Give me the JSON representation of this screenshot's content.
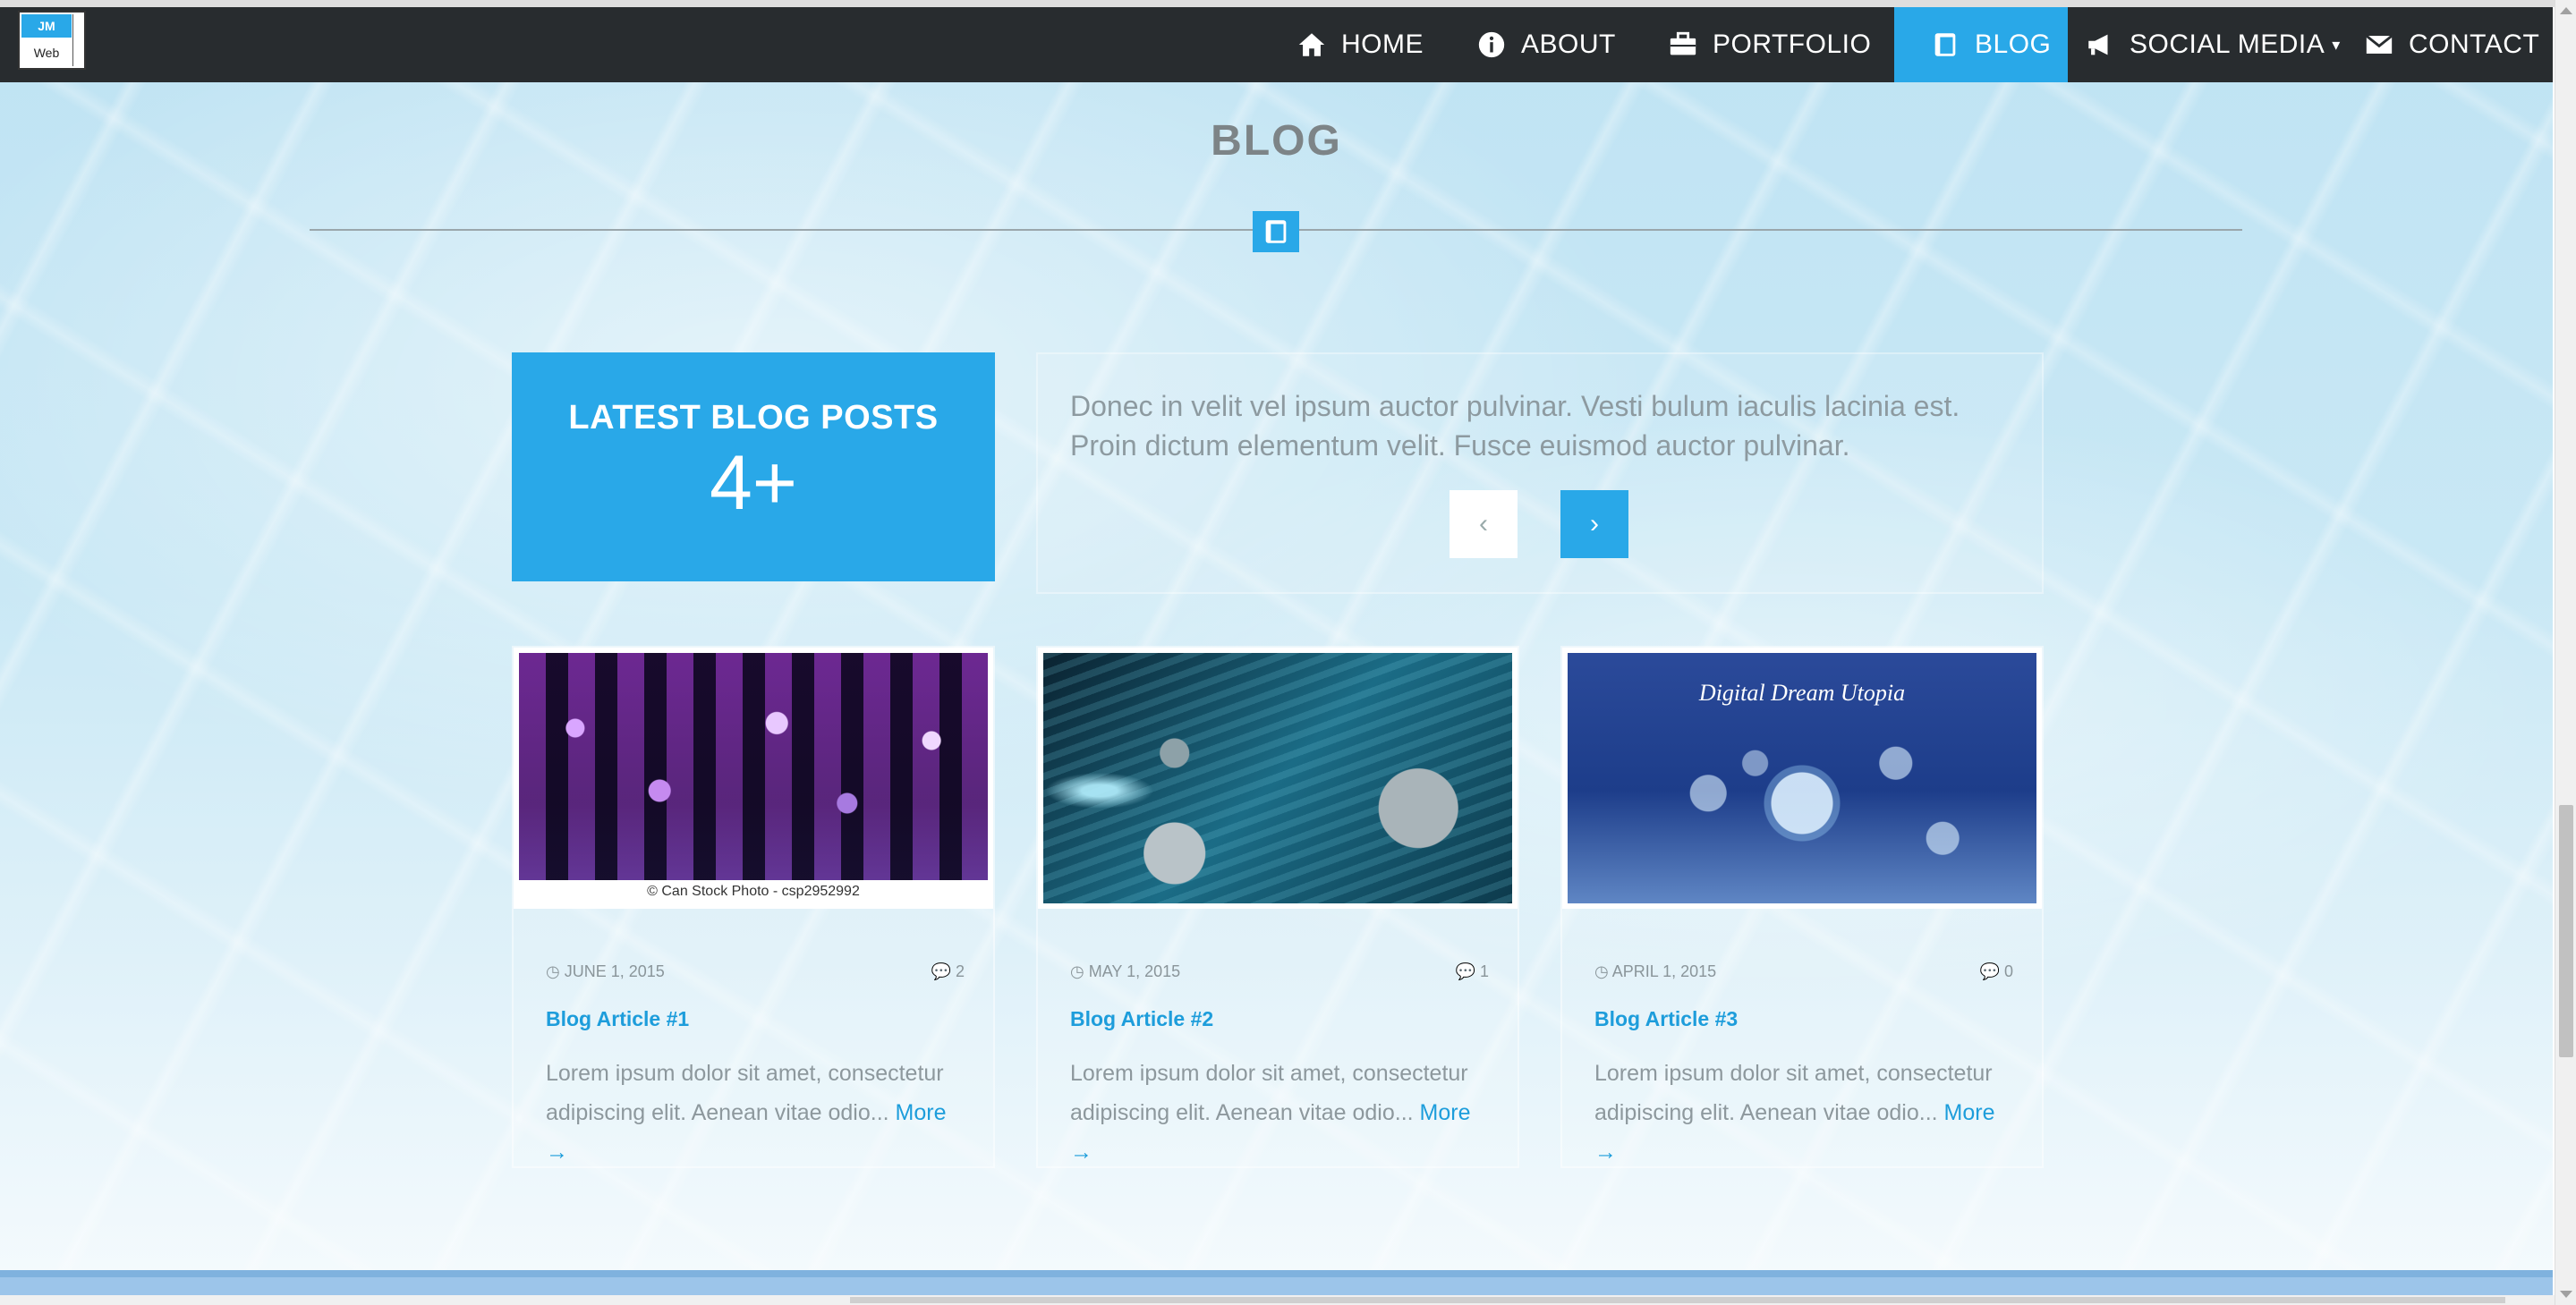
{
  "logo": {
    "top": "JM",
    "bottom": "Web"
  },
  "nav": {
    "items": [
      {
        "label": "HOME",
        "icon": "home-icon"
      },
      {
        "label": "ABOUT",
        "icon": "info-icon"
      },
      {
        "label": "PORTFOLIO",
        "icon": "briefcase-icon"
      },
      {
        "label": "BLOG",
        "icon": "book-icon",
        "active": true
      },
      {
        "label": "SOCIAL MEDIA",
        "icon": "megaphone-icon",
        "caret": "▾"
      },
      {
        "label": "CONTACT",
        "icon": "envelope-icon"
      }
    ]
  },
  "section": {
    "title": "BLOG"
  },
  "latest": {
    "title": "LATEST BLOG POSTS",
    "count": "4+"
  },
  "quote": {
    "text": "Donec in velit vel ipsum auctor pulvinar. Vesti bulum iaculis lacinia est. Proin dictum elementum velit. Fusce euismod auctor pulvinar.",
    "prev": "‹",
    "next": "›"
  },
  "cards": [
    {
      "date": "JUNE 1, 2015",
      "comments": "2",
      "title": "Blog Article #1",
      "excerpt": "Lorem ipsum dolor sit amet, consectetur adipiscing elit. Aenean vitae odio...",
      "more": "More →",
      "image_caption": "© Can Stock Photo - csp2952992"
    },
    {
      "date": "MAY 1, 2015",
      "comments": "1",
      "title": "Blog Article #2",
      "excerpt": "Lorem ipsum dolor sit amet, consectetur adipiscing elit. Aenean vitae odio...",
      "more": "More →"
    },
    {
      "date": "APRIL 1, 2015",
      "comments": "0",
      "title": "Blog Article #3",
      "excerpt": "Lorem ipsum dolor sit amet, consectetur adipiscing elit. Aenean vitae odio...",
      "more": "More →",
      "image_caption": "Digital Dream Utopia"
    }
  ],
  "colors": {
    "accent": "#29a8e8",
    "navbar": "#282c2f",
    "link": "#1d9ddb"
  }
}
